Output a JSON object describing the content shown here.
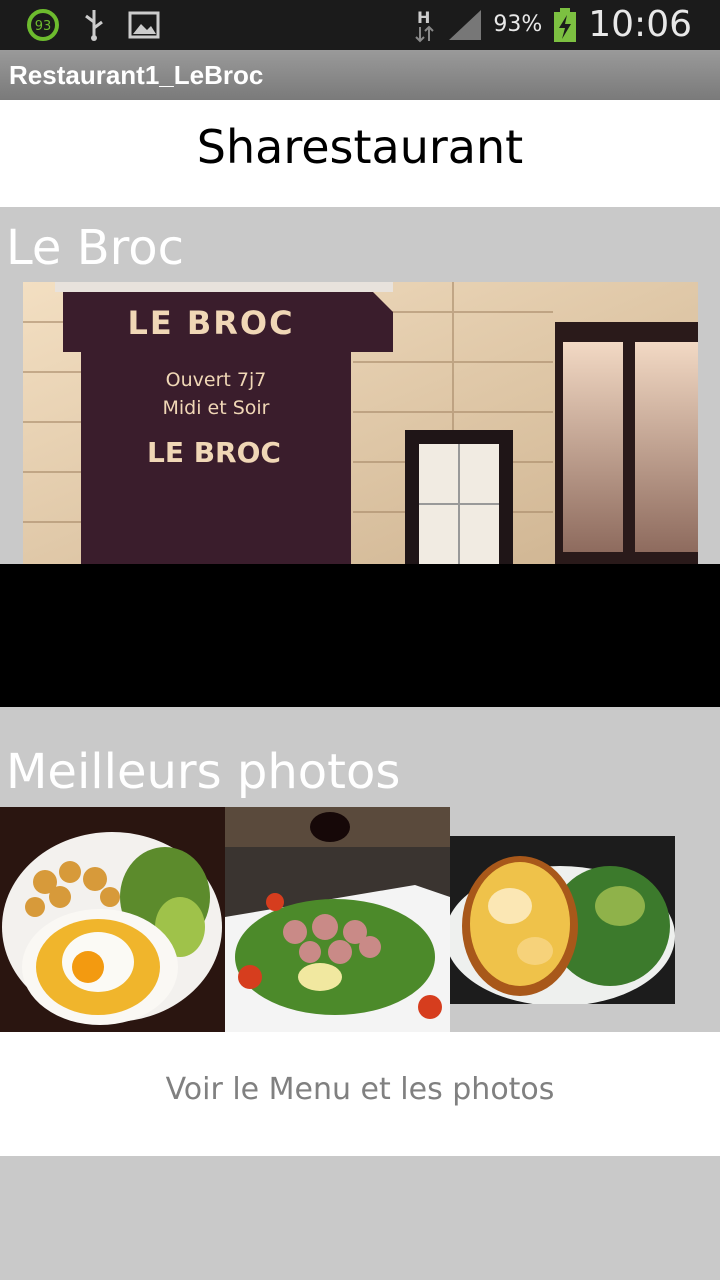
{
  "status_bar": {
    "notification_badge": "93",
    "icons": [
      "usb-icon",
      "image-icon",
      "h-data-icon",
      "signal-icon",
      "battery-charging-icon"
    ],
    "battery": "93%",
    "time": "10:06"
  },
  "window": {
    "title": "Restaurant1_LeBroc"
  },
  "header": {
    "title": "Sharestaurant"
  },
  "restaurant": {
    "name": "Le Broc",
    "sign_name": "LE BROC",
    "sign_line1": "Ouvert 7j7",
    "sign_line2": "Midi et Soir",
    "sign_name2": "LE BROC"
  },
  "photos": {
    "title": "Meilleurs photos",
    "items": [
      "photo-egg-gratin",
      "photo-salad",
      "photo-gratin-salad"
    ]
  },
  "menu_button": {
    "label": "Voir le Menu et les photos"
  }
}
